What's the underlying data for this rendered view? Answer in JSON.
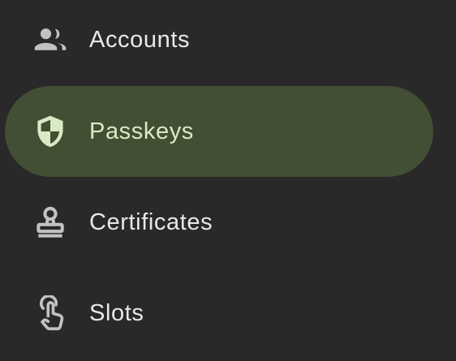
{
  "nav": {
    "items": [
      {
        "label": "Accounts",
        "icon": "people-icon",
        "active": false
      },
      {
        "label": "Passkeys",
        "icon": "shield-icon",
        "active": true
      },
      {
        "label": "Certificates",
        "icon": "stamp-icon",
        "active": false
      },
      {
        "label": "Slots",
        "icon": "touch-icon",
        "active": false
      }
    ]
  },
  "colors": {
    "background": "#292929",
    "active_pill": "#424F34",
    "active_text": "#D8EBC4",
    "text": "#E8E8E4",
    "icon": "#C2C2C2"
  }
}
